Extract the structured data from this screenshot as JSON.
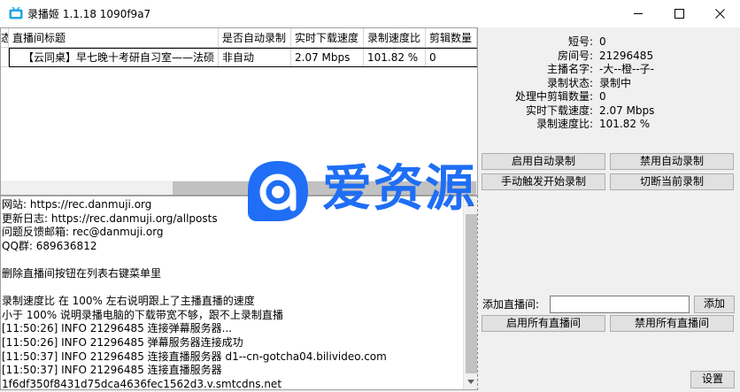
{
  "window": {
    "title": "录播姬 1.1.18 1090f9a7",
    "minimize_glyph": "—",
    "maximize_glyph": "☐",
    "close_glyph": "✕"
  },
  "grid": {
    "columns": [
      "状态",
      "直播间标题",
      "是否自动录制",
      "实时下载速度",
      "录制速度比",
      "剪辑数量"
    ],
    "rows": [
      [
        "",
        "【云同桌】早七晚十考研自习室——法硕",
        "非自动",
        "2.07 Mbps",
        "101.82 %",
        "0"
      ]
    ]
  },
  "log": {
    "lines": [
      "网站:  https://rec.danmuji.org",
      "更新日志:  https://rec.danmuji.org/allposts",
      "问题反馈邮箱:  rec@danmuji.org",
      "QQ群:  689636812",
      "",
      "删除直播间按钮在列表右键菜单里",
      "",
      "录制速度比 在 100% 左右说明跟上了主播直播的速度",
      "小于 100% 说明录播电脑的下载带宽不够，跟不上录制直播",
      "[11:50:26] INFO 21296485 连接弹幕服务器...",
      "[11:50:26] INFO 21296485 弹幕服务器连接成功",
      "[11:50:37] INFO 21296485 连接直播服务器 d1--cn-gotcha04.bilivideo.com",
      "[11:50:37] INFO 21296485 连接直播服务器",
      "1f6df350f8431d75dca4636fec1562d3.v.smtcdns.net"
    ]
  },
  "info": {
    "items": [
      {
        "label": "短号:",
        "value": "0"
      },
      {
        "label": "房间号:",
        "value": "21296485"
      },
      {
        "label": "主播名字:",
        "value": "-大--橙--子-"
      },
      {
        "label": "录制状态:",
        "value": "录制中"
      },
      {
        "label": "处理中剪辑数量:",
        "value": "0"
      },
      {
        "label": "实时下载速度:",
        "value": "2.07 Mbps"
      },
      {
        "label": "录制速度比:",
        "value": "101.82 %"
      }
    ]
  },
  "buttons": {
    "enable_auto": "启用自动录制",
    "disable_auto": "禁用自动录制",
    "manual_start": "手动触发开始录制",
    "cut_current": "切断当前录制",
    "add": "添加",
    "enable_all": "启用所有直播间",
    "disable_all": "禁用所有直播间",
    "settings": "设置"
  },
  "add_room": {
    "label": "添加直播间:",
    "value": ""
  },
  "watermark": {
    "text": "爱资源"
  },
  "colors": {
    "watermark_blue": "#1f6ef5"
  }
}
